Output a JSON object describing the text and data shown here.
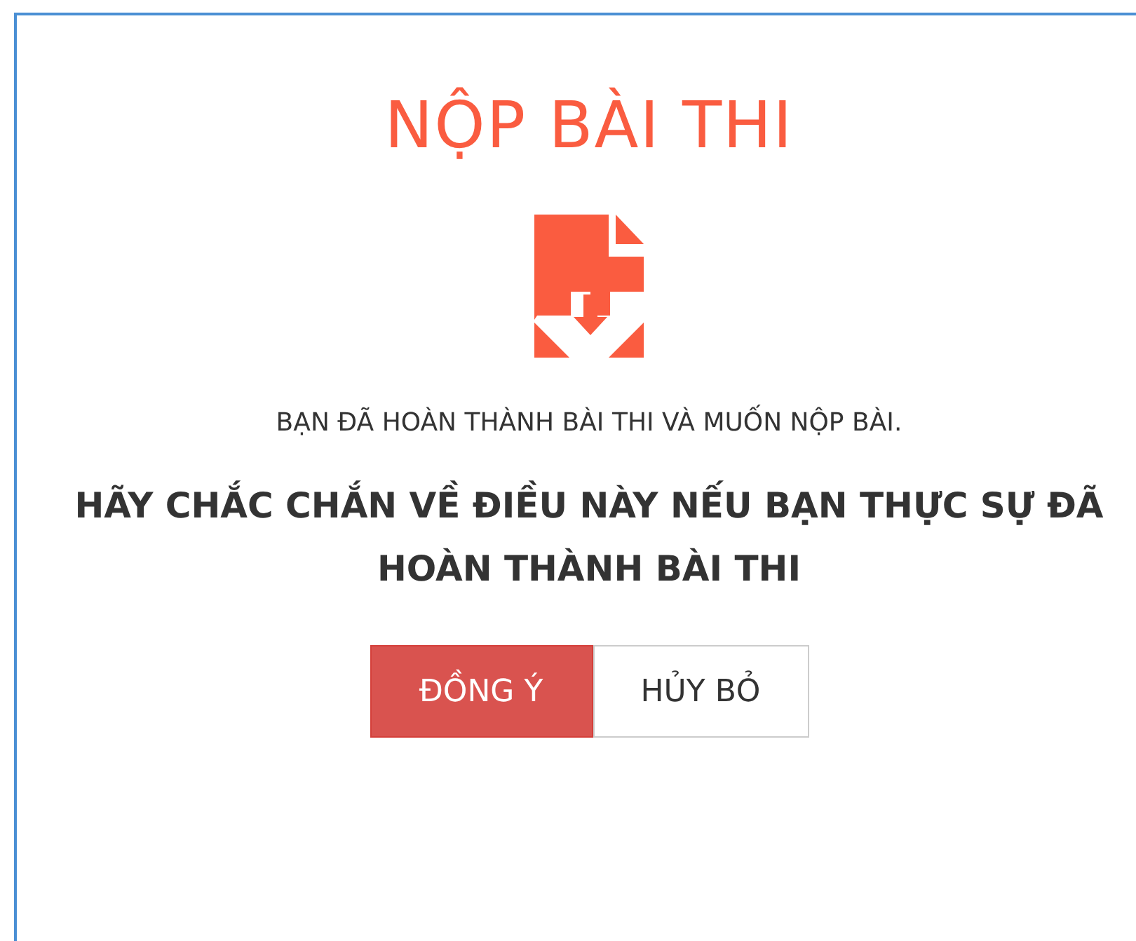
{
  "dialog": {
    "title": "NỘP BÀI THI",
    "message": "BẠN ĐÃ HOÀN THÀNH BÀI THI VÀ MUỐN NỘP BÀI.",
    "warning": "HÃY CHẮC CHẮN VỀ ĐIỀU NÀY NẾU BẠN THỰC SỰ ĐÃ HOÀN THÀNH BÀI THI",
    "buttons": [
      {
        "label": "ĐỒNG Ý",
        "kind": "primary"
      },
      {
        "label": "HỦY BỎ",
        "kind": "default"
      }
    ]
  }
}
